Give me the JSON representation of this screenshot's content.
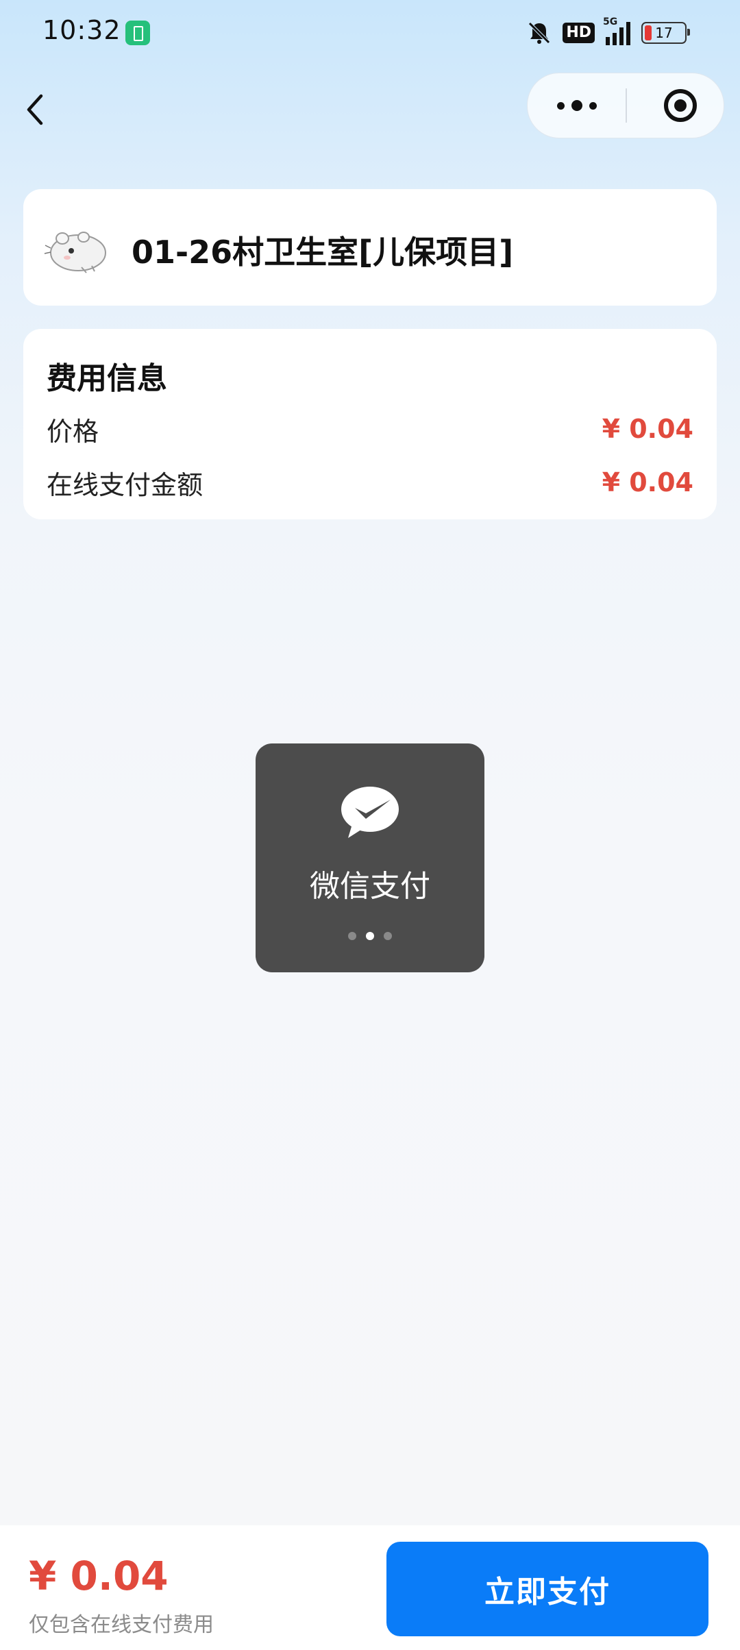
{
  "status_bar": {
    "time": "10:32",
    "network_tag": "5G",
    "hd_label": "HD",
    "battery_level": "17",
    "battery_fill_fraction": 0.17
  },
  "nav": {
    "icons": [
      "back-arrow-icon",
      "more-dots-icon",
      "target-icon"
    ]
  },
  "clinic": {
    "title": "01-26村卫生室[儿保项目]"
  },
  "fee": {
    "heading": "费用信息",
    "rows": [
      {
        "label": "价格",
        "value": "¥ 0.04"
      },
      {
        "label": "在线支付金额",
        "value": "¥ 0.04"
      }
    ]
  },
  "toast": {
    "text": "微信支付",
    "icon": "wechat-pay-icon",
    "active_dot": 2,
    "dot_count": 3
  },
  "footer": {
    "total": "¥ 0.04",
    "note": "仅包含在线支付费用",
    "pay_label": "立即支付"
  },
  "colors": {
    "accent": "#0a7cf8",
    "price": "#e14a3d",
    "toast_bg": "#4c4c4c"
  }
}
